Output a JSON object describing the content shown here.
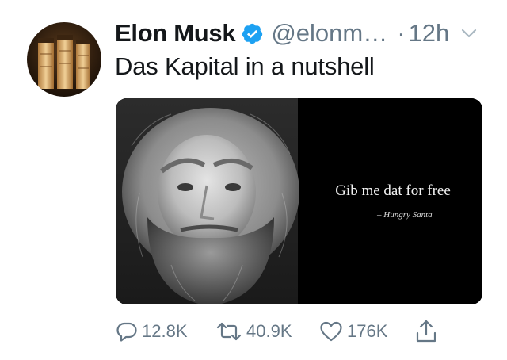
{
  "tweet": {
    "author": {
      "name": "Elon Musk",
      "handle": "@elonm…",
      "verified": true
    },
    "separator": "·",
    "time": "12h",
    "text": "Das Kapital in a nutshell",
    "media": {
      "quote": "Gib me dat for free",
      "attribution": "– Hungry Santa"
    },
    "actions": {
      "reply_count": "12.8K",
      "retweet_count": "40.9K",
      "like_count": "176K"
    }
  },
  "colors": {
    "verified": "#1da1f2",
    "secondary_text": "#657786",
    "primary_text": "#14171a",
    "media_background": "#000000"
  },
  "icons": {
    "verified": "verified-badge-icon",
    "menu": "chevron-down-icon",
    "reply": "reply-bubble-icon",
    "retweet": "retweet-arrows-icon",
    "like": "heart-icon",
    "share": "share-upload-icon"
  }
}
